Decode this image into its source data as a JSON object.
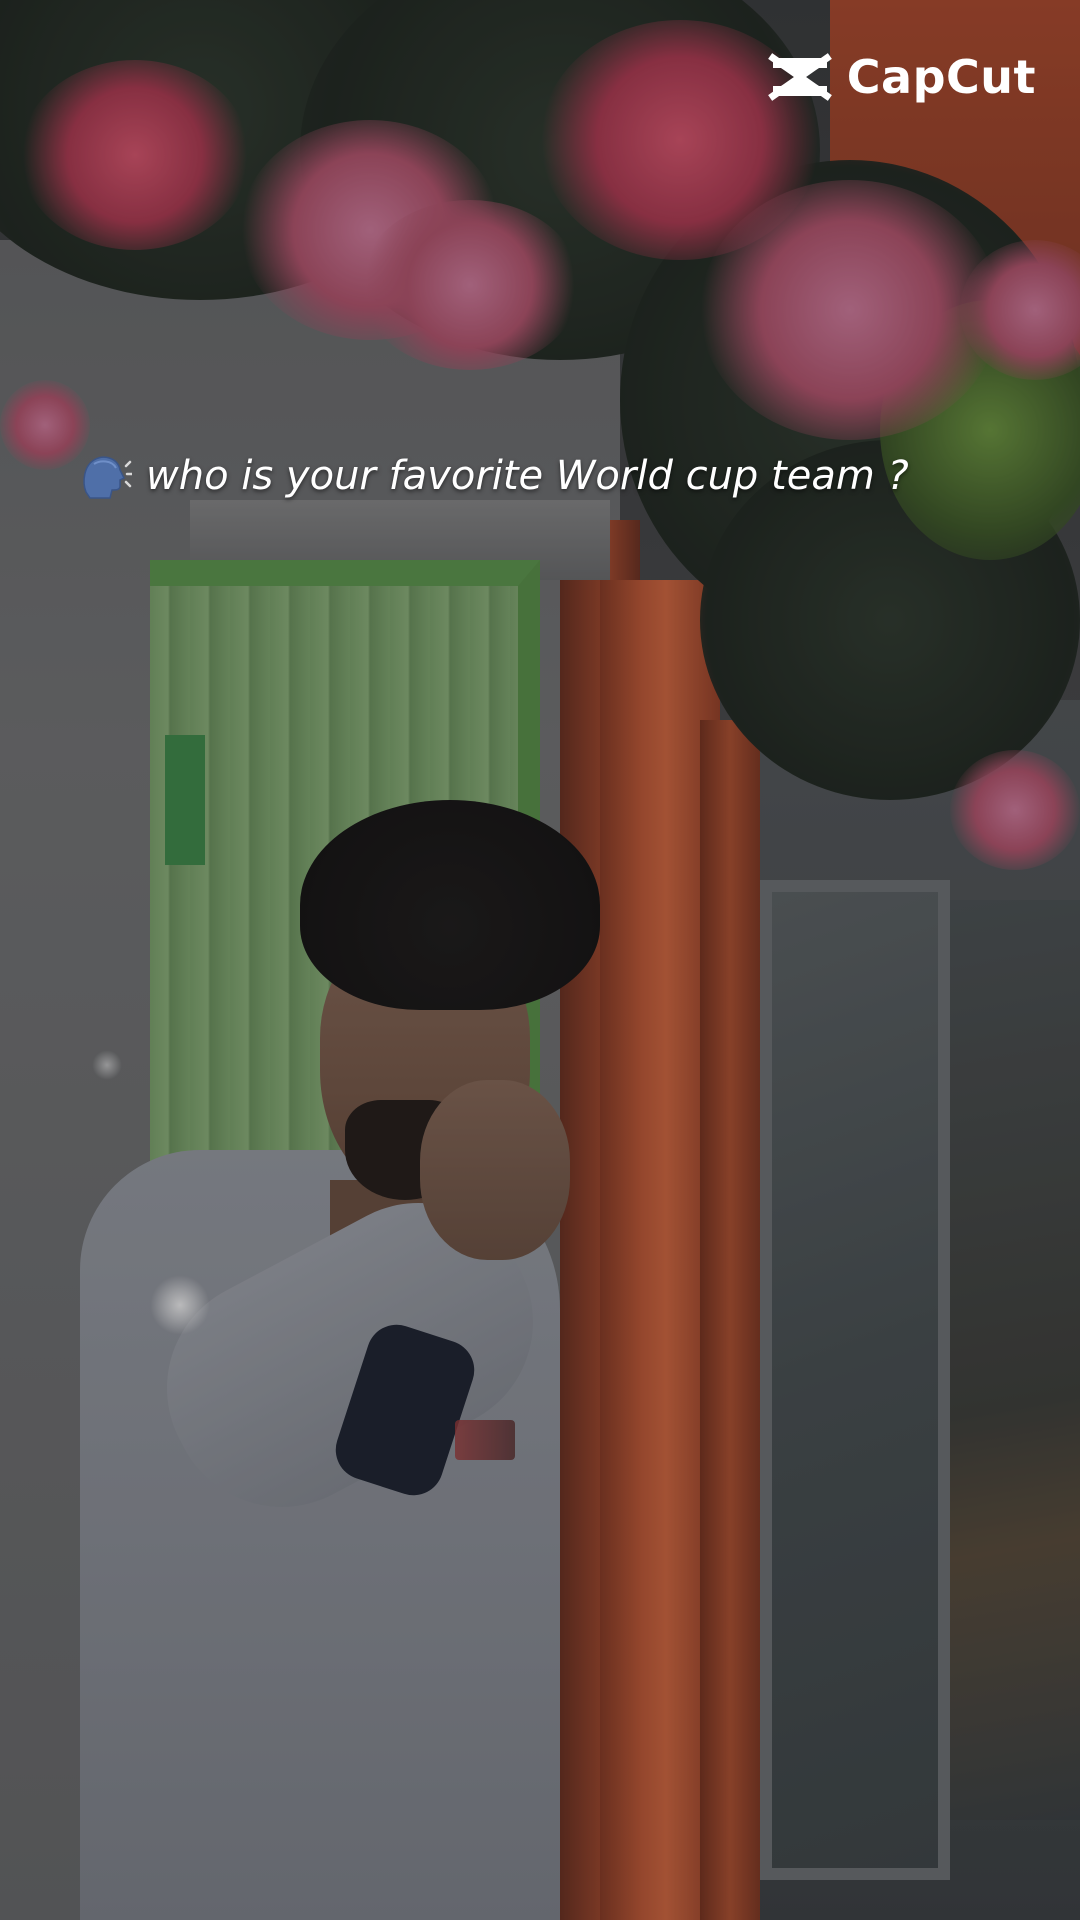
{
  "watermark": {
    "brand": "CapCut",
    "icon": "capcut-logo-icon"
  },
  "caption": {
    "icon": "speaking-head-icon",
    "text": "who is your favorite World cup team ?"
  },
  "colors": {
    "caption_text": "#ffffff",
    "watermark_text": "#ffffff"
  }
}
